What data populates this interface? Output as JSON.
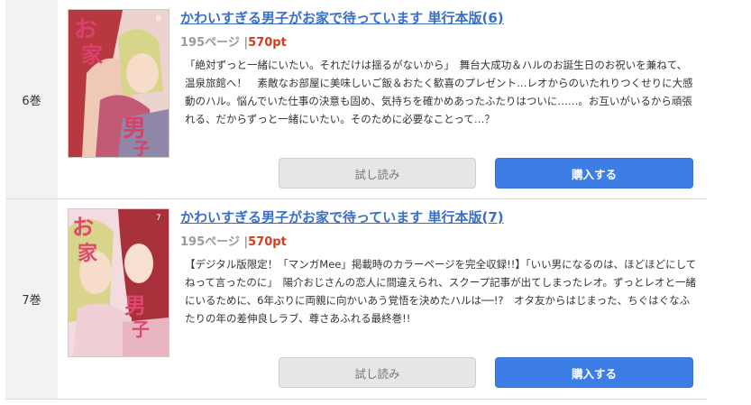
{
  "books": [
    {
      "volume": "6巻",
      "title": "かわいすぎる男子がお家で待っています 単行本版(6)",
      "pages": "195ページ",
      "separator": "|",
      "price": "570pt",
      "description": "「絶対ずっと一緒にいたい。それだけは揺るがないから」　舞台大成功＆ハルのお誕生日のお祝いを兼ねて、温泉旅館へ！　素敵なお部屋に美味しいご飯＆おたく歓喜のプレゼント…レオからのいたれりつくせりに大感動のハル。悩んでいた仕事の決意も固め、気持ちを確かめあったふたりはついに……。お互いがいるから頑張れる、だからずっと一緒にいたい。そのために必要なことって…？",
      "trial_label": "試し読み",
      "buy_label": "購入する",
      "cover_colors": {
        "bg": "#e9c6c4",
        "accent": "#d9416a",
        "hair": "#b8383f"
      }
    },
    {
      "volume": "7巻",
      "title": "かわいすぎる男子がお家で待っています 単行本版(7)",
      "pages": "195ページ",
      "separator": "|",
      "price": "570pt",
      "description": "【デジタル版限定！「マンガMee」掲載時のカラーページを完全収録!!】「いい男になるのは、ほどほどにしてねって言ったのに」　陽介おじさんの恋人に間違えられ、スクープ記事が出てしまったレオ。ずっとレオと一緒にいるために、6年ぶりに両親に向かいあう覚悟を決めたハルは──!?　オタ友からはじまった、ちぐはぐなふたりの年の差伸良しラブ、尊さあふれる最終巻!!",
      "trial_label": "試し読み",
      "buy_label": "購入する",
      "cover_colors": {
        "bg": "#f3dbe0",
        "accent": "#e0476e",
        "hair": "#a8303a"
      }
    }
  ]
}
